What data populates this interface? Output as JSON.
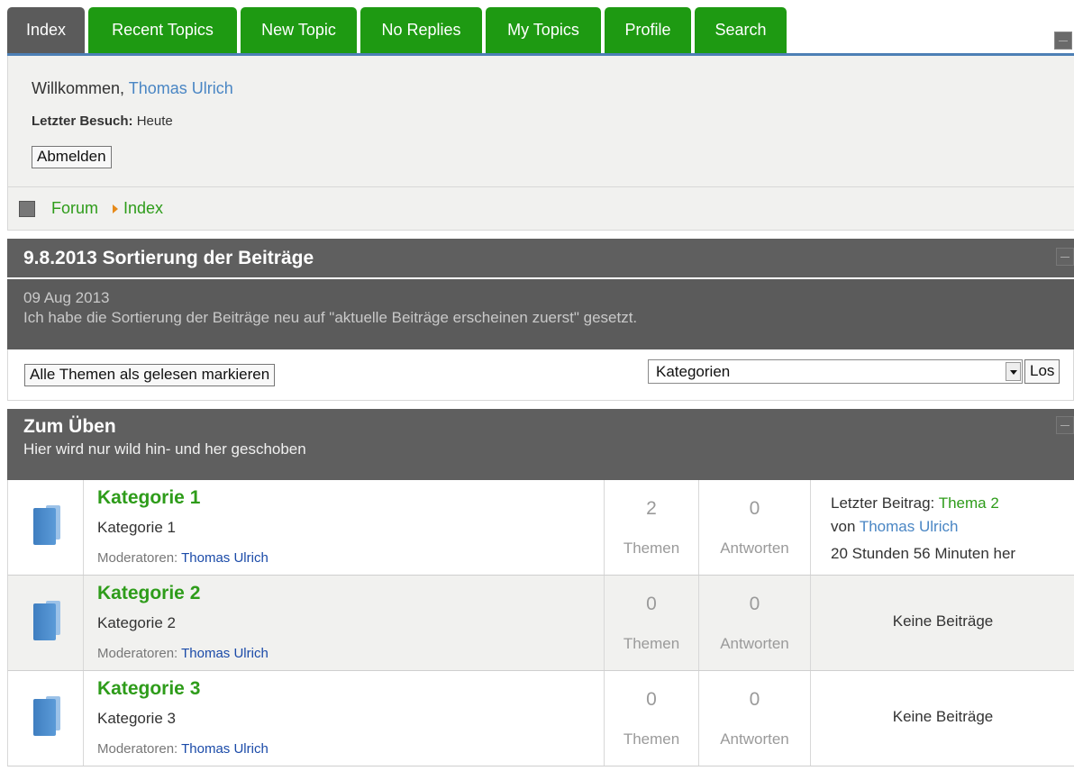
{
  "tabs": [
    {
      "label": "Index"
    },
    {
      "label": "Recent Topics"
    },
    {
      "label": "New Topic"
    },
    {
      "label": "No Replies"
    },
    {
      "label": "My Topics"
    },
    {
      "label": "Profile"
    },
    {
      "label": "Search"
    }
  ],
  "welcome": {
    "greeting": "Willkommen,",
    "user": "Thomas Ulrich",
    "last_visit_label": "Letzter Besuch:",
    "last_visit_value": "Heute",
    "logout_label": "Abmelden"
  },
  "breadcrumb": {
    "forum": "Forum",
    "index": "Index"
  },
  "announcement": {
    "title": "9.8.2013 Sortierung der Beiträge",
    "date": "09 Aug 2013",
    "text": "Ich habe die Sortierung der Beiträge neu auf \"aktuelle Beiträge erscheinen zuerst\" gesetzt."
  },
  "controls": {
    "mark_read_label": "Alle Themen als gelesen markieren",
    "select_value": "Kategorien",
    "go_label": "Los"
  },
  "section": {
    "title": "Zum Üben",
    "description": "Hier wird nur wild hin- und her geschoben"
  },
  "categories": [
    {
      "name": "Kategorie 1",
      "description": "Kategorie 1",
      "moderators_label": "Moderatoren:",
      "moderator": "Thomas Ulrich",
      "topics": "2",
      "topics_label": "Themen",
      "replies": "0",
      "replies_label": "Antworten",
      "last_post_label": "Letzter Beitrag:",
      "last_post_topic": "Thema 2",
      "by_label": "von",
      "last_post_user": "Thomas Ulrich",
      "last_post_time": "20 Stunden 56 Minuten her"
    },
    {
      "name": "Kategorie 2",
      "description": "Kategorie 2",
      "moderators_label": "Moderatoren:",
      "moderator": "Thomas Ulrich",
      "topics": "0",
      "topics_label": "Themen",
      "replies": "0",
      "replies_label": "Antworten",
      "no_posts": "Keine Beiträge"
    },
    {
      "name": "Kategorie 3",
      "description": "Kategorie 3",
      "moderators_label": "Moderatoren:",
      "moderator": "Thomas Ulrich",
      "topics": "0",
      "topics_label": "Themen",
      "replies": "0",
      "replies_label": "Antworten",
      "no_posts": "Keine Beiträge"
    }
  ]
}
